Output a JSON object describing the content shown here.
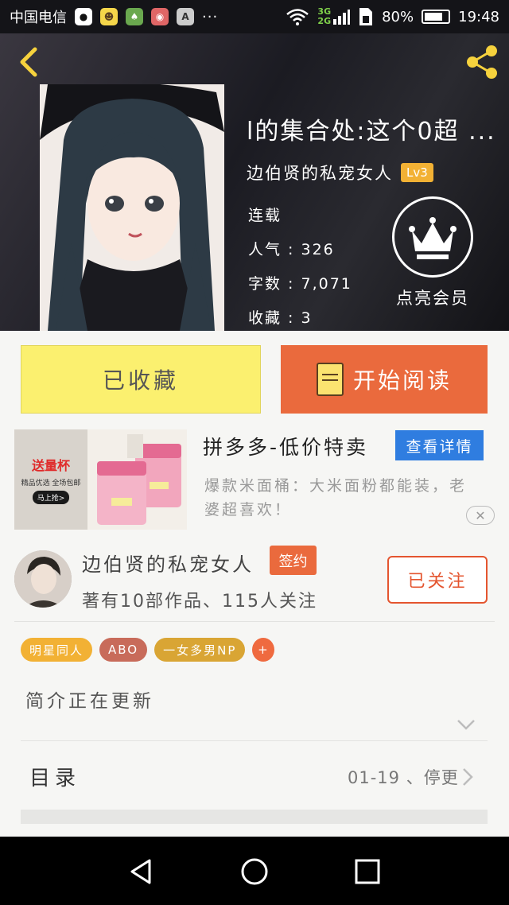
{
  "status_bar": {
    "carrier": "中国电信",
    "network_3g": "3G",
    "network_2g": "2G",
    "battery": "80%",
    "battery_level": 0.8,
    "time": "19:48"
  },
  "book": {
    "title": "l的集合处:这个0超 ...",
    "author": "边伯贤的私宠女人",
    "level": "Lv3",
    "status": "连载",
    "popularity": "人气 : 326",
    "word_count": "字数 : 7,071",
    "favorites": "收藏 : 3"
  },
  "membership": {
    "label": "点亮会员"
  },
  "actions": {
    "collected": "已收藏",
    "start_reading": "开始阅读"
  },
  "ad": {
    "slogan": "送量杯",
    "sub": "精品优选 全场包邮",
    "buy": "马上抢>",
    "title": "拼多多-低价特卖",
    "detail_button": "查看详情",
    "description": "爆款米面桶：大米面粉都能装，老婆超喜欢！"
  },
  "author_info": {
    "name": "边伯贤的私宠女人",
    "badge": "签约",
    "stats": "著有10部作品、115人关注",
    "follow_button": "已关注"
  },
  "tags": [
    {
      "label": "明星同人",
      "color": "#f2b134"
    },
    {
      "label": "ABO",
      "color": "#c86b5a"
    },
    {
      "label": "一女多男NP",
      "color": "#d9a534"
    }
  ],
  "add_tag": "+",
  "intro": "简介正在更新",
  "catalog": {
    "label": "目录",
    "status": "01-19 、停更"
  },
  "colors": {
    "accent_orange": "#ea6a3d",
    "collected_yellow": "#fbf06f",
    "detail_blue": "#2f7de0",
    "level_gold": "#f2b134"
  }
}
